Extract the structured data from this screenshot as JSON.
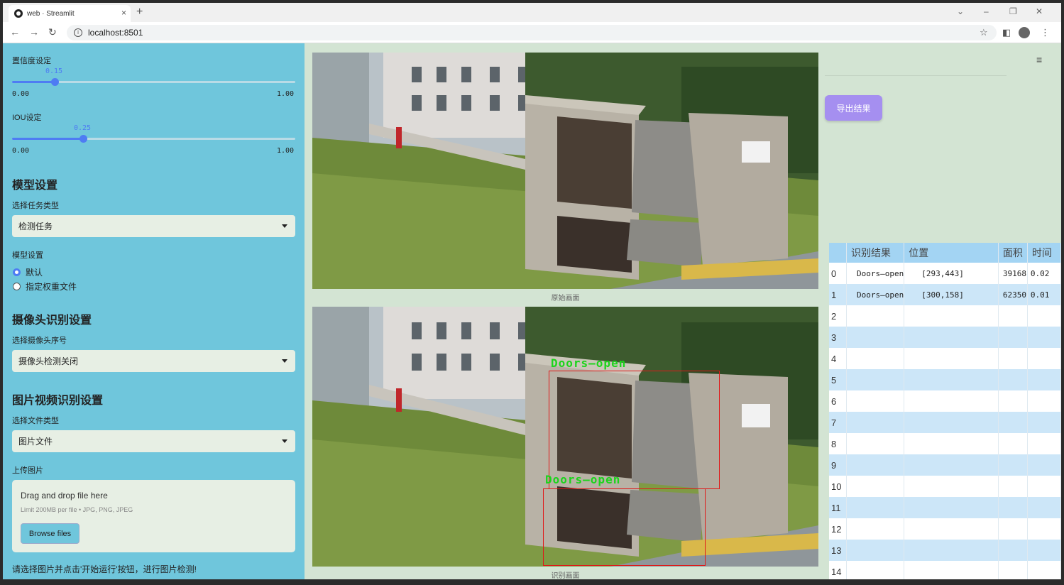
{
  "browser": {
    "tab_title": "web · Streamlit",
    "tab_close": "×",
    "new_tab": "+",
    "url": "localhost:8501",
    "window_controls": [
      "⌄",
      "–",
      "❐",
      "✕"
    ]
  },
  "sidebar": {
    "confidence": {
      "label": "置信度设定",
      "value": "0.15",
      "fraction": 0.15,
      "min": "0.00",
      "max": "1.00"
    },
    "iou": {
      "label": "IOU设定",
      "value": "0.25",
      "fraction": 0.25,
      "min": "0.00",
      "max": "1.00"
    },
    "model_heading": "模型设置",
    "task_label": "选择任务类型",
    "task_value": "检测任务",
    "model_label": "模型设置",
    "model_options": [
      {
        "label": "默认",
        "selected": true
      },
      {
        "label": "指定权重文件",
        "selected": false
      }
    ],
    "camera_heading": "摄像头识别设置",
    "camera_label": "选择摄像头序号",
    "camera_value": "摄像头检测关闭",
    "file_heading": "图片视频识别设置",
    "file_type_label": "选择文件类型",
    "file_type_value": "图片文件",
    "upload_label": "上传图片",
    "uploader": {
      "drag_text": "Drag and drop file here",
      "limit_text": "Limit 200MB per file • JPG, PNG, JPEG",
      "browse_button": "Browse files"
    },
    "hint": "请选择图片并点击'开始运行'按钮，进行图片检测!"
  },
  "main": {
    "original_caption": "原始画面",
    "result_caption": "识别画面",
    "detections": [
      {
        "label": "Doors—open"
      },
      {
        "label": "Doors—open"
      }
    ],
    "export_button": "导出结果",
    "menu_icon": "≡"
  },
  "table": {
    "headers": [
      "",
      "识别结果",
      "位置",
      "面积",
      "时间"
    ],
    "rows": [
      {
        "idx": "0",
        "result": "Doors—open",
        "position": "[293,443]",
        "area": "39168",
        "time": "0.02"
      },
      {
        "idx": "1",
        "result": "Doors—open",
        "position": "[300,158]",
        "area": "62350",
        "time": "0.01"
      },
      {
        "idx": "2",
        "result": "",
        "position": "",
        "area": "",
        "time": ""
      },
      {
        "idx": "3",
        "result": "",
        "position": "",
        "area": "",
        "time": ""
      },
      {
        "idx": "4",
        "result": "",
        "position": "",
        "area": "",
        "time": ""
      },
      {
        "idx": "5",
        "result": "",
        "position": "",
        "area": "",
        "time": ""
      },
      {
        "idx": "6",
        "result": "",
        "position": "",
        "area": "",
        "time": ""
      },
      {
        "idx": "7",
        "result": "",
        "position": "",
        "area": "",
        "time": ""
      },
      {
        "idx": "8",
        "result": "",
        "position": "",
        "area": "",
        "time": ""
      },
      {
        "idx": "9",
        "result": "",
        "position": "",
        "area": "",
        "time": ""
      },
      {
        "idx": "10",
        "result": "",
        "position": "",
        "area": "",
        "time": ""
      },
      {
        "idx": "11",
        "result": "",
        "position": "",
        "area": "",
        "time": ""
      },
      {
        "idx": "12",
        "result": "",
        "position": "",
        "area": "",
        "time": ""
      },
      {
        "idx": "13",
        "result": "",
        "position": "",
        "area": "",
        "time": ""
      },
      {
        "idx": "14",
        "result": "",
        "position": "",
        "area": "",
        "time": ""
      }
    ]
  },
  "colors": {
    "sidebar_bg": "#6fc6dc",
    "main_bg": "#d3e4d3",
    "accent": "#4e7cf3",
    "export_button": "#a58ff0",
    "detection_box": "#e01818",
    "detection_text": "#1bd41b"
  }
}
